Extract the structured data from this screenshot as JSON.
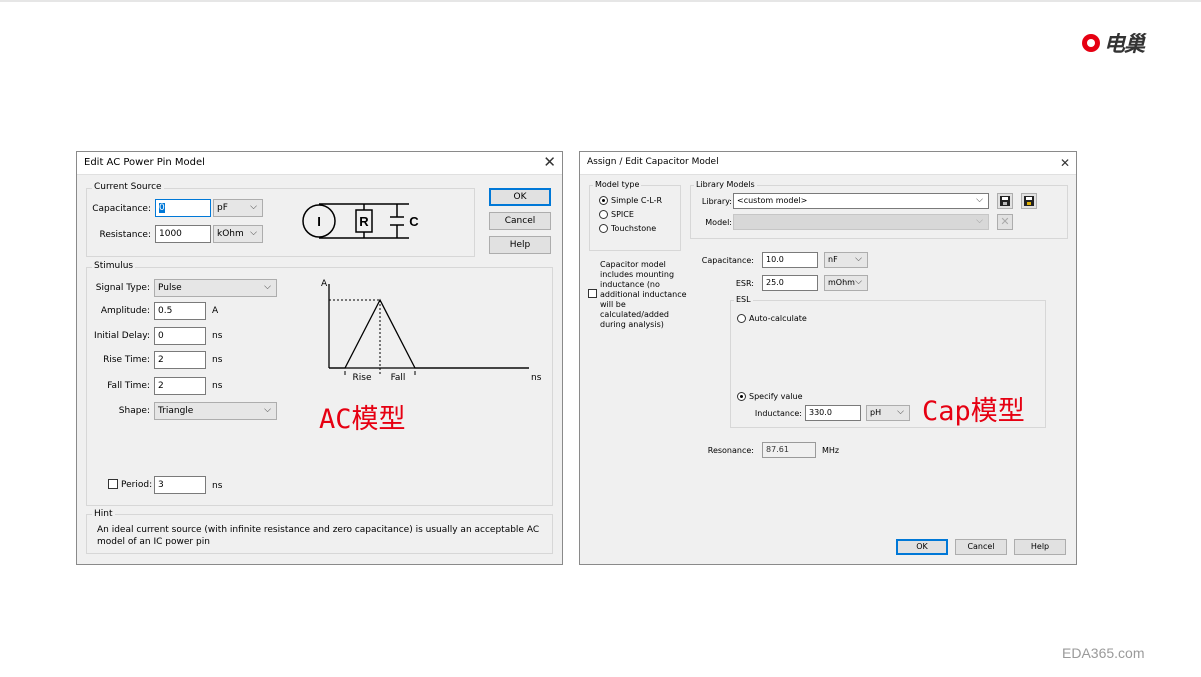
{
  "brand": {
    "logo_text": "电巢"
  },
  "footer": {
    "text": "EDA365.com"
  },
  "ac_dialog": {
    "title": "Edit AC Power Pin Model",
    "current_source": {
      "label": "Current Source",
      "capacitance_label": "Capacitance:",
      "capacitance_value": "0",
      "capacitance_unit": "pF",
      "resistance_label": "Resistance:",
      "resistance_value": "1000",
      "resistance_unit": "kOhm",
      "circuit_labels": {
        "i": "I",
        "r": "R",
        "c": "C"
      }
    },
    "buttons": {
      "ok": "OK",
      "cancel": "Cancel",
      "help": "Help"
    },
    "stimulus": {
      "label": "Stimulus",
      "signal_type_label": "Signal Type:",
      "signal_type_value": "Pulse",
      "amplitude_label": "Amplitude:",
      "amplitude_value": "0.5",
      "amplitude_unit": "A",
      "initial_delay_label": "Initial Delay:",
      "initial_delay_value": "0",
      "initial_delay_unit": "ns",
      "rise_time_label": "Rise Time:",
      "rise_time_value": "2",
      "rise_time_unit": "ns",
      "fall_time_label": "Fall Time:",
      "fall_time_value": "2",
      "fall_time_unit": "ns",
      "shape_label": "Shape:",
      "shape_value": "Triangle",
      "period_label": "Period:",
      "period_value": "3",
      "period_unit": "ns",
      "period_checked": false,
      "waveform": {
        "y_label": "A",
        "rise_label": "Rise",
        "fall_label": "Fall",
        "x_unit": "ns"
      }
    },
    "hint": {
      "label": "Hint",
      "text_line1": "An ideal current source (with infinite resistance and zero capacitance) is usually an acceptable AC",
      "text_line2": "model of an IC power pin"
    },
    "annotation": "AC模型"
  },
  "cap_dialog": {
    "title": "Assign / Edit Capacitor Model",
    "model_type": {
      "label": "Model type",
      "options": [
        "Simple C-L-R",
        "SPICE",
        "Touchstone"
      ],
      "selected": "Simple C-L-R"
    },
    "library_models": {
      "label": "Library Models",
      "library_label": "Library:",
      "library_value": "<custom model>",
      "model_label": "Model:",
      "model_value": ""
    },
    "mounting_checkbox": {
      "line1": "Capacitor model",
      "line2": "includes mounting",
      "line3": "inductance (no",
      "line4": "additional inductance",
      "line5": "will be",
      "line6": "calculated/added",
      "line7": "during analysis)",
      "checked": false
    },
    "capacitance_label": "Capacitance:",
    "capacitance_value": "10.0",
    "capacitance_unit": "nF",
    "esr_label": "ESR:",
    "esr_value": "25.0",
    "esr_unit": "mOhm",
    "esl": {
      "label": "ESL",
      "auto_label": "Auto-calculate",
      "specify_label": "Specify value",
      "selected": "Specify value",
      "inductance_label": "Inductance:",
      "inductance_value": "330.0",
      "inductance_unit": "pH"
    },
    "resonance_label": "Resonance:",
    "resonance_value": "87.61",
    "resonance_unit": "MHz",
    "buttons": {
      "ok": "OK",
      "cancel": "Cancel",
      "help": "Help"
    },
    "annotation": "Cap模型"
  }
}
